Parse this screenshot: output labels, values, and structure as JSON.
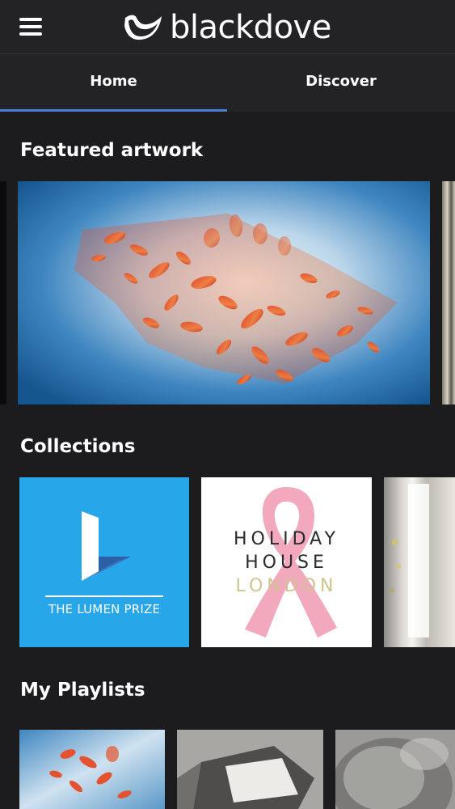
{
  "app": {
    "brand_name": "blackdove"
  },
  "nav": {
    "tabs": [
      {
        "label": "Home",
        "active": true
      },
      {
        "label": "Discover",
        "active": false
      }
    ],
    "accent_color": "#4a7fd6"
  },
  "sections": {
    "featured": {
      "title": "Featured artwork"
    },
    "collections": {
      "title": "Collections",
      "items": [
        {
          "label": "THE LUMEN PRIZE",
          "background": "#27a7ea"
        },
        {
          "label_lines": [
            "HOLIDAY",
            "HOUSE",
            "LONDON"
          ],
          "background": "#ffffff"
        },
        {
          "background": "#d9d6d0"
        }
      ]
    },
    "playlists": {
      "title": "My Playlists"
    }
  },
  "icons": {
    "menu": "hamburger-menu-icon",
    "logo": "dove-logo-icon",
    "ribbon": "pink-ribbon-icon"
  }
}
